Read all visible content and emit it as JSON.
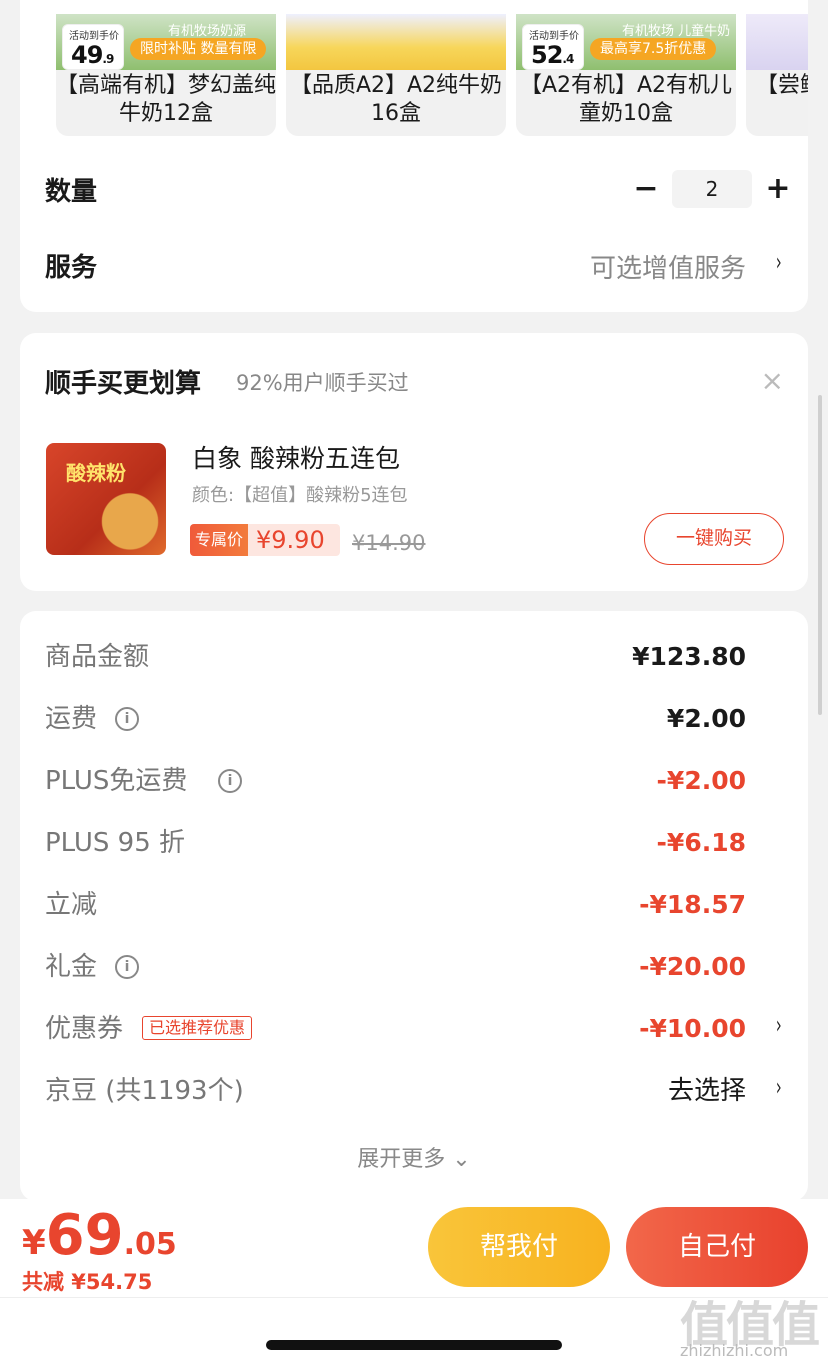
{
  "products": [
    {
      "name": "【高端有机】梦幻盖纯牛奶12盒",
      "price_label": "活动到手价",
      "price_int": "49",
      "price_dec": ".9",
      "tag1": "有机牧场奶源",
      "tag2": "限时补贴 数量有限"
    },
    {
      "name": "【品质A2】A2纯牛奶16盒"
    },
    {
      "name": "【A2有机】A2有机儿童奶10盒",
      "price_label": "活动到手价",
      "price_int": "52",
      "price_dec": ".4",
      "tag1": "有机牧场 儿童牛奶",
      "tag2": "最高享7.5折优惠"
    },
    {
      "name": "【尝鲜】儿"
    }
  ],
  "quantity": {
    "label": "数量",
    "minus": "−",
    "value": "2",
    "plus": "+"
  },
  "service": {
    "label": "服务",
    "value": "可选增值服务",
    "chevron": "›"
  },
  "upsell": {
    "title": "顺手买更划算",
    "subtitle": "92%用户顺手买过",
    "close": "×",
    "product_img_text": "酸辣粉",
    "product_name": "白象 酸辣粉五连包",
    "product_color": "颜色:【超值】酸辣粉5连包",
    "exclusive_tag": "专属价",
    "exclusive_price": "¥9.90",
    "original_price": "¥14.90",
    "buy_button": "一键购买"
  },
  "summary": {
    "rows": [
      {
        "label": "商品金额",
        "value": "¥123.80"
      },
      {
        "label": "运费",
        "value": "¥2.00",
        "info": "i"
      },
      {
        "label": "PLUS免运费",
        "value": "-¥2.00",
        "info": "i"
      },
      {
        "label": "PLUS 95 折",
        "value": "-¥6.18"
      },
      {
        "label": "立减",
        "value": "-¥18.57"
      },
      {
        "label": "礼金",
        "value": "-¥20.00",
        "info": "i"
      },
      {
        "label": "优惠券",
        "value": "-¥10.00",
        "tag": "已选推荐优惠",
        "chevron": "›"
      },
      {
        "label": "京豆 (共1193个)",
        "value": "去选择",
        "chevron": "›"
      }
    ],
    "expand": "展开更多 ⌄"
  },
  "bottom": {
    "currency": "¥",
    "total_int": "69",
    "total_dec": ".05",
    "saved": "共减 ¥54.75",
    "help_pay": "帮我付",
    "self_pay": "自己付"
  },
  "watermark": {
    "big": "值值值",
    "small": "zhizhizhi.com"
  },
  "colors": {
    "accent": "#e8452e",
    "help_button": "#f8b21f"
  }
}
